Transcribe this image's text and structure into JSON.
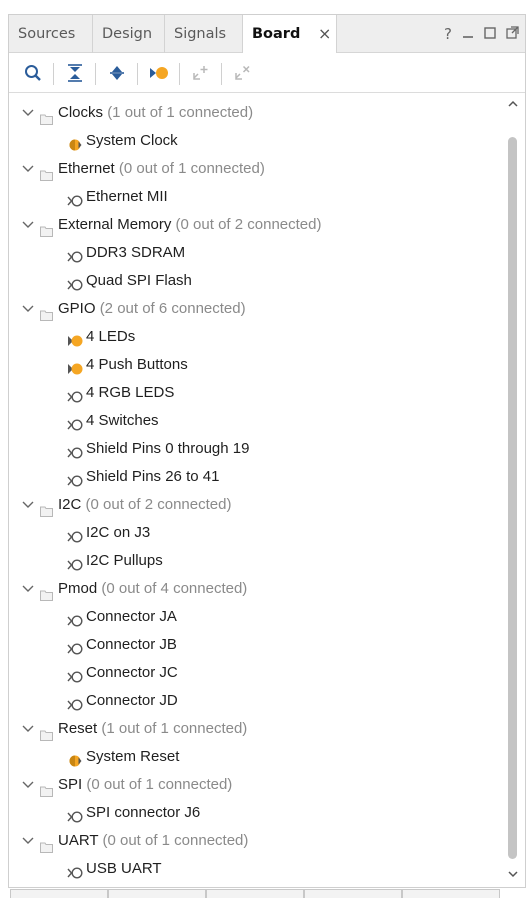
{
  "tabs": [
    {
      "label": "Sources",
      "active": false
    },
    {
      "label": "Design",
      "active": false
    },
    {
      "label": "Signals",
      "active": false
    },
    {
      "label": "Board",
      "active": true
    }
  ],
  "tab_close_glyph": "×",
  "window_controls": {
    "help": "?",
    "minimize": "–",
    "maximize": "☐",
    "float": "⧉"
  },
  "toolbar": {
    "icons": [
      "search-icon",
      "collapse-all-icon",
      "expand-all-icon",
      "show-connected-icon",
      "auto-connect-icon",
      "disconnect-icon"
    ]
  },
  "colors": {
    "accent_orange": "#f5a623",
    "connector_gray": "#555555",
    "count_gray": "#8a8a8a"
  },
  "tree": {
    "groups": [
      {
        "name": "Clocks",
        "count": "(1 out of 1 connected)",
        "items": [
          {
            "label": "System Clock",
            "state": "connected-partial"
          }
        ]
      },
      {
        "name": "Ethernet",
        "count": "(0 out of 1 connected)",
        "items": [
          {
            "label": "Ethernet MII",
            "state": "unconnected"
          }
        ]
      },
      {
        "name": "External Memory",
        "count": "(0 out of 2 connected)",
        "items": [
          {
            "label": "DDR3 SDRAM",
            "state": "unconnected"
          },
          {
            "label": "Quad SPI Flash",
            "state": "unconnected"
          }
        ]
      },
      {
        "name": "GPIO",
        "count": "(2 out of 6 connected)",
        "items": [
          {
            "label": "4 LEDs",
            "state": "connected"
          },
          {
            "label": "4 Push Buttons",
            "state": "connected"
          },
          {
            "label": "4 RGB LEDS",
            "state": "unconnected"
          },
          {
            "label": "4 Switches",
            "state": "unconnected"
          },
          {
            "label": "Shield Pins 0 through 19",
            "state": "unconnected"
          },
          {
            "label": "Shield Pins 26 to 41",
            "state": "unconnected"
          }
        ]
      },
      {
        "name": "I2C",
        "count": "(0 out of 2 connected)",
        "items": [
          {
            "label": "I2C on J3",
            "state": "unconnected"
          },
          {
            "label": "I2C Pullups",
            "state": "unconnected"
          }
        ]
      },
      {
        "name": "Pmod",
        "count": "(0 out of 4 connected)",
        "items": [
          {
            "label": "Connector JA",
            "state": "unconnected"
          },
          {
            "label": "Connector JB",
            "state": "unconnected"
          },
          {
            "label": "Connector JC",
            "state": "unconnected"
          },
          {
            "label": "Connector JD",
            "state": "unconnected"
          }
        ]
      },
      {
        "name": "Reset",
        "count": "(1 out of 1 connected)",
        "items": [
          {
            "label": "System Reset",
            "state": "connected-partial"
          }
        ]
      },
      {
        "name": "SPI",
        "count": "(0 out of 1 connected)",
        "items": [
          {
            "label": "SPI connector J6",
            "state": "unconnected"
          }
        ]
      },
      {
        "name": "UART",
        "count": "(0 out of 1 connected)",
        "items": [
          {
            "label": "USB UART",
            "state": "unconnected"
          }
        ]
      }
    ]
  }
}
